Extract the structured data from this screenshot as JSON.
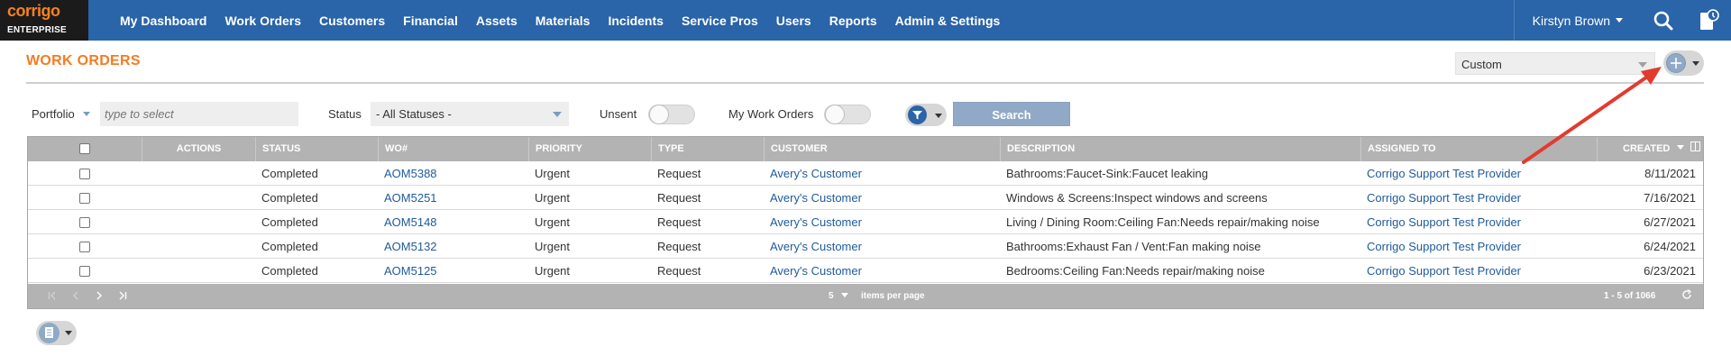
{
  "app": {
    "logo_line1": "corrigo",
    "logo_line2": "ENTERPRISE",
    "brand_color": "#2a64a9",
    "accent_color": "#f27c24"
  },
  "nav": {
    "items": [
      "My Dashboard",
      "Work Orders",
      "Customers",
      "Financial",
      "Assets",
      "Materials",
      "Incidents",
      "Service Pros",
      "Users",
      "Reports",
      "Admin & Settings"
    ],
    "user_name": "Kirstyn Brown",
    "icons": [
      "search-icon",
      "notifications-icon"
    ]
  },
  "page": {
    "title": "WORK ORDERS",
    "view_select": "Custom",
    "add_icon": "plus-icon"
  },
  "filters": {
    "portfolio_label": "Portfolio",
    "portfolio_placeholder": "type to select",
    "status_label": "Status",
    "status_value": "- All Statuses -",
    "unsent_label": "Unsent",
    "unsent_on": false,
    "my_work_orders_label": "My Work Orders",
    "my_work_orders_on": false,
    "filter_icon": "filter-icon",
    "search_label": "Search"
  },
  "grid": {
    "columns": [
      "",
      "Actions",
      "Status",
      "WO#",
      "Priority",
      "Type",
      "Customer",
      "Description",
      "Assigned To",
      "Created"
    ],
    "rows": [
      {
        "status": "Completed",
        "wo": "AOM5388",
        "priority": "Urgent",
        "type": "Request",
        "customer": "Avery's Customer",
        "description": "Bathrooms:Faucet-Sink:Faucet leaking",
        "assigned": "Corrigo Support Test Provider",
        "created": "8/11/2021"
      },
      {
        "status": "Completed",
        "wo": "AOM5251",
        "priority": "Urgent",
        "type": "Request",
        "customer": "Avery's Customer",
        "description": "Windows & Screens:Inspect windows and screens",
        "assigned": "Corrigo Support Test Provider",
        "created": "7/16/2021"
      },
      {
        "status": "Completed",
        "wo": "AOM5148",
        "priority": "Urgent",
        "type": "Request",
        "customer": "Avery's Customer",
        "description": "Living / Dining Room:Ceiling Fan:Needs repair/making noise",
        "assigned": "Corrigo Support Test Provider",
        "created": "6/27/2021"
      },
      {
        "status": "Completed",
        "wo": "AOM5132",
        "priority": "Urgent",
        "type": "Request",
        "customer": "Avery's Customer",
        "description": "Bathrooms:Exhaust Fan / Vent:Fan making noise",
        "assigned": "Corrigo Support Test Provider",
        "created": "6/24/2021"
      },
      {
        "status": "Completed",
        "wo": "AOM5125",
        "priority": "Urgent",
        "type": "Request",
        "customer": "Avery's Customer",
        "description": "Bedrooms:Ceiling Fan:Needs repair/making noise",
        "assigned": "Corrigo Support Test Provider",
        "created": "6/23/2021"
      }
    ],
    "footer": {
      "page_size": "5",
      "items_per_page_label": "items per page",
      "range_text": "1 - 5 of 1066"
    }
  },
  "bottom": {
    "action_icon": "document-icon"
  }
}
